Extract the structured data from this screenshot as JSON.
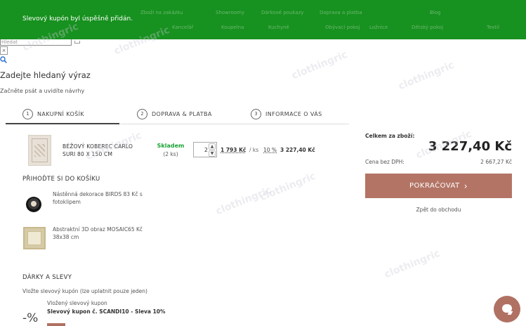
{
  "toast": {
    "message": "Slevový kupón byl úspěšně přidán.",
    "ghost_links": [
      "Zboží na zakázku",
      "Showroomy",
      "Dárkové poukazy",
      "Doprava a platba",
      "Blog",
      "Kancelář",
      "Koupelna",
      "Kuchyně",
      "Obývací pokoj",
      "Ložnice",
      "Dětský pokoj",
      "Dekorace",
      "Textil"
    ]
  },
  "search": {
    "placeholder": "Hledat",
    "close_symbol": "×",
    "heading": "Zadejte hledaný výraz",
    "hint": "Začněte psát a uvidíte návrhy"
  },
  "steps": [
    {
      "num": "1",
      "label": "NAKUPNÍ KOŠÍK"
    },
    {
      "num": "2",
      "label": "DOPRAVA & PLATBA"
    },
    {
      "num": "3",
      "label": "INFORMACE O VÁS"
    }
  ],
  "cart": {
    "item": {
      "name": "BÉŽOVÝ KOBEREC CARLO SURI 80 X 150 CM",
      "stock_label": "Skladem",
      "stock_count": "(2 ks)",
      "quantity": "2",
      "unit_price": "1 793 Kč",
      "per_unit": "/ ks",
      "vat": "10 %",
      "total": "3 227,40 Kč"
    }
  },
  "addons": {
    "heading": "PŘIHOĎTE SI DO KOŠÍKU",
    "items": [
      {
        "text": "Nástěnná dekorace BIRDS 83 Kč s fotoklipem"
      },
      {
        "text": "Abstraktní 3D obraz MOSAIC65 Kč 38x38 cm"
      }
    ]
  },
  "gifts": {
    "heading": "DÁRKY A SLEVY",
    "hint": "Vložte slevový kupón (lze uplatnit pouze jeden)",
    "percent_symbol": "-%",
    "coupon_label": "Vložený slevový kupon",
    "coupon_name": "Slevový kupon č. SCANDI10 - Sleva 10%"
  },
  "summary": {
    "total_label": "Celkem za zboží:",
    "total": "3 227,40 Kč",
    "novat_label": "Cena bez DPH:",
    "novat": "2 667,27 Kč",
    "continue_label": "POKRAČOVAT",
    "continue_chevron": "›",
    "back_label": "Zpět do obchodu"
  },
  "watermark": "clothingric",
  "colors": {
    "toast_green": "#17911f",
    "accent_brown": "#b37466",
    "stock_green": "#1aa336"
  },
  "icons": [
    "search-icon",
    "chevron-right-icon",
    "chat-icon",
    "spinner-up-icon",
    "spinner-down-icon"
  ]
}
